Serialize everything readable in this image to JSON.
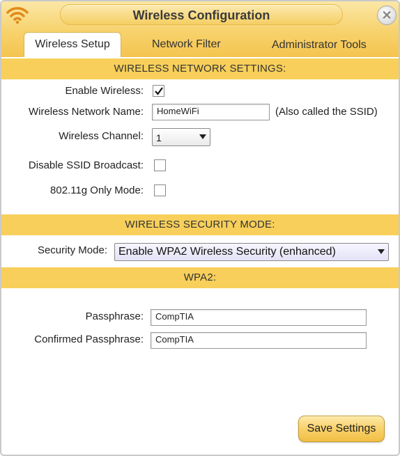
{
  "window": {
    "title": "Wireless Configuration",
    "close_glyph": "✕"
  },
  "tabs": [
    {
      "label": "Wireless Setup",
      "active": true
    },
    {
      "label": "Network Filter",
      "active": false
    },
    {
      "label": "Administrator Tools",
      "active": false
    }
  ],
  "wireless_network_settings": {
    "header": "WIRELESS NETWORK SETTINGS:",
    "enable_wireless": {
      "label": "Enable Wireless:",
      "checked": true
    },
    "network_name": {
      "label": "Wireless Network Name:",
      "value": "HomeWiFi",
      "note": "(Also called the SSID)"
    },
    "channel": {
      "label": "Wireless Channel:",
      "selected": "1"
    },
    "disable_ssid_broadcast": {
      "label": "Disable SSID Broadcast:",
      "checked": false
    },
    "g_only_mode": {
      "label": "802.11g Only Mode:",
      "checked": false
    }
  },
  "security": {
    "header": "WIRELESS SECURITY MODE:",
    "mode_label": "Security Mode:",
    "mode_selected": "Enable WPA2 Wireless Security (enhanced)"
  },
  "wpa2": {
    "header": "WPA2:",
    "passphrase_label": "Passphrase:",
    "passphrase_value": "CompTIA",
    "confirm_label": "Confirmed Passphrase:",
    "confirm_value": "CompTIA"
  },
  "save_button_label": "Save Settings",
  "icons": {
    "wifi": "wifi-signal-icon",
    "checkmark": "checkmark-icon",
    "dropdown": "chevron-down-icon",
    "close": "close-icon"
  },
  "colors": {
    "accent": "#f7cf5a",
    "title_bar": "#f4c44e",
    "button": "#f8d16a"
  }
}
